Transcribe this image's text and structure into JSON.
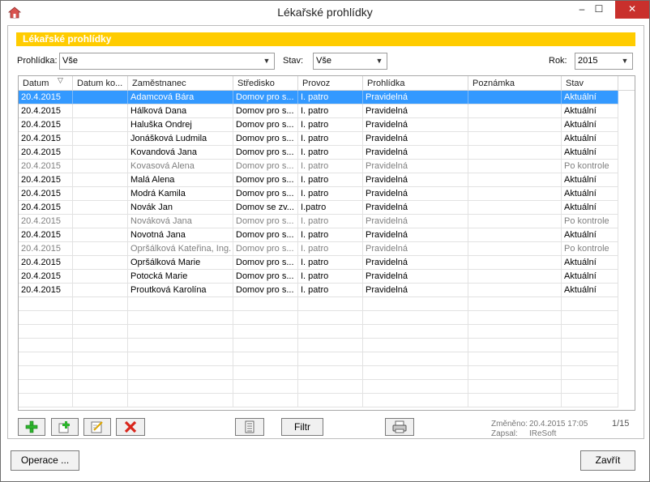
{
  "window": {
    "title": "Lékařské prohlídky",
    "minimize_glyph": "–",
    "maximize_glyph": "☐",
    "close_glyph": "✕"
  },
  "panel": {
    "header": "Lékařské prohlídky"
  },
  "filters": {
    "prohlidka_label": "Prohlídka:",
    "prohlidka_value": "Vše",
    "stav_label": "Stav:",
    "stav_value": "Vše",
    "rok_label": "Rok:",
    "rok_value": "2015"
  },
  "table": {
    "columns": [
      "Datum",
      "Datum ko...",
      "Zaměstnanec",
      "Středisko",
      "Provoz",
      "Prohlídka",
      "Poznámka",
      "Stav"
    ],
    "rows": [
      {
        "cells": [
          "20.4.2015",
          "",
          "Adamcová Bára",
          "Domov pro s...",
          "I. patro",
          "Pravidelná",
          "",
          "Aktuální"
        ],
        "state": "selected"
      },
      {
        "cells": [
          "20.4.2015",
          "",
          "Hálková Dana",
          "Domov pro s...",
          "I. patro",
          "Pravidelná",
          "",
          "Aktuální"
        ],
        "state": "normal"
      },
      {
        "cells": [
          "20.4.2015",
          "",
          "Haluška Ondrej",
          "Domov pro s...",
          "I. patro",
          "Pravidelná",
          "",
          "Aktuální"
        ],
        "state": "normal"
      },
      {
        "cells": [
          "20.4.2015",
          "",
          "Jonášková Ludmila",
          "Domov pro s...",
          "I. patro",
          "Pravidelná",
          "",
          "Aktuální"
        ],
        "state": "normal"
      },
      {
        "cells": [
          "20.4.2015",
          "",
          "Kovandová Jana",
          "Domov pro s...",
          "I. patro",
          "Pravidelná",
          "",
          "Aktuální"
        ],
        "state": "normal"
      },
      {
        "cells": [
          "20.4.2015",
          "",
          "Kovasová Alena",
          "Domov pro s...",
          "I. patro",
          "Pravidelná",
          "",
          "Po kontrole"
        ],
        "state": "dim"
      },
      {
        "cells": [
          "20.4.2015",
          "",
          "Malá Alena",
          "Domov pro s...",
          "I. patro",
          "Pravidelná",
          "",
          "Aktuální"
        ],
        "state": "normal"
      },
      {
        "cells": [
          "20.4.2015",
          "",
          "Modrá Kamila",
          "Domov pro s...",
          "I. patro",
          "Pravidelná",
          "",
          "Aktuální"
        ],
        "state": "normal"
      },
      {
        "cells": [
          "20.4.2015",
          "",
          "Novák Jan",
          "Domov se zv...",
          "I.patro",
          "Pravidelná",
          "",
          "Aktuální"
        ],
        "state": "normal"
      },
      {
        "cells": [
          "20.4.2015",
          "",
          "Nováková Jana",
          "Domov pro s...",
          "I. patro",
          "Pravidelná",
          "",
          "Po kontrole"
        ],
        "state": "dim"
      },
      {
        "cells": [
          "20.4.2015",
          "",
          "Novotná Jana",
          "Domov pro s...",
          "I. patro",
          "Pravidelná",
          "",
          "Aktuální"
        ],
        "state": "normal"
      },
      {
        "cells": [
          "20.4.2015",
          "",
          "Opršálková Kateřina, Ing.",
          "Domov pro s...",
          "I. patro",
          "Pravidelná",
          "",
          "Po kontrole"
        ],
        "state": "dim"
      },
      {
        "cells": [
          "20.4.2015",
          "",
          "Opršálková Marie",
          "Domov pro s...",
          "I. patro",
          "Pravidelná",
          "",
          "Aktuální"
        ],
        "state": "normal"
      },
      {
        "cells": [
          "20.4.2015",
          "",
          "Potocká Marie",
          "Domov pro s...",
          "I. patro",
          "Pravidelná",
          "",
          "Aktuální"
        ],
        "state": "normal"
      },
      {
        "cells": [
          "20.4.2015",
          "",
          "Proutková Karolína",
          "Domov pro s...",
          "I. patro",
          "Pravidelná",
          "",
          "Aktuální"
        ],
        "state": "normal"
      }
    ]
  },
  "toolbar": {
    "add_icon": "plus-green",
    "add_copy_icon": "add-copy",
    "edit_icon": "edit-pencil",
    "delete_icon": "red-cross",
    "list_icon": "list-document",
    "filter_label": "Filtr",
    "print_icon": "printer"
  },
  "meta": {
    "changed_label": "Změněno:",
    "changed_value": "20.4.2015 17:05",
    "author_label": "Zapsal:",
    "author_value": "IReSoft",
    "counter": "1/15"
  },
  "footer": {
    "operace_label": "Operace ...",
    "close_label": "Zavřít"
  },
  "colors": {
    "accent": "#ffcc00",
    "selection": "#3399ff",
    "dim_text": "#808080"
  }
}
